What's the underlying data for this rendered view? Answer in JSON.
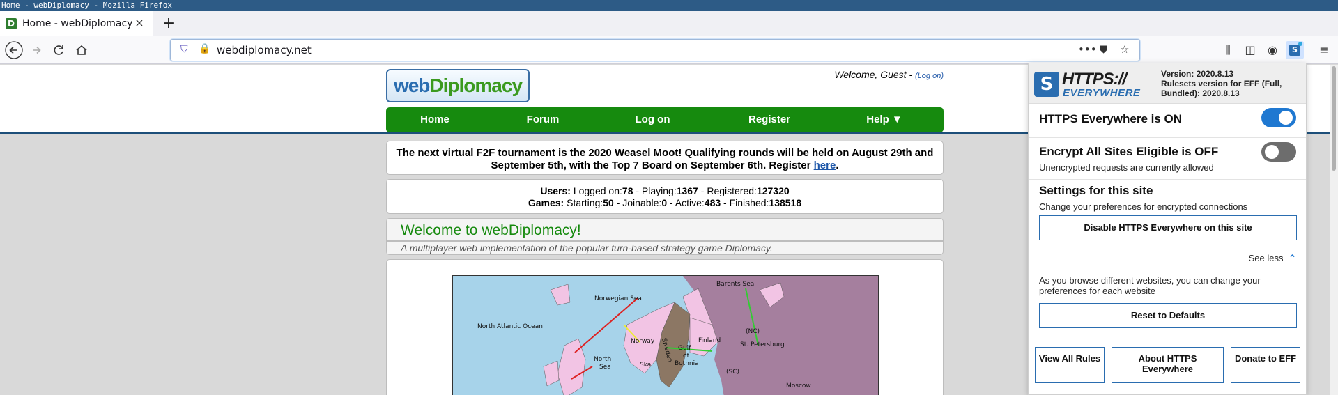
{
  "window": {
    "title": "Home - webDiplomacy - Mozilla Firefox"
  },
  "tab": {
    "title": "Home - webDiplomacy",
    "favicon_letter": "D",
    "close": "×"
  },
  "new_tab": "+",
  "address_bar": {
    "url": "webdiplomacy.net"
  },
  "site": {
    "logo_web": "web",
    "logo_diplomacy": "Diplomacy",
    "welcome_text": "Welcome, Guest - ",
    "welcome_login_open": "(",
    "welcome_login": "Log on",
    "welcome_login_close": ")",
    "menu": [
      "Home",
      "Forum",
      "Log on",
      "Register",
      "Help ▼"
    ],
    "announcement_text": "The next virtual F2F tournament is the 2020 Weasel Moot! Qualifying rounds will be held on August 29th and September 5th, with the Top 7 Board on September 6th. Register ",
    "announcement_link": "here",
    "announcement_end": ".",
    "stats": {
      "users_label": "Users:",
      "logged_on_label": " Logged on:",
      "logged_on": "78",
      "playing_label": " - Playing:",
      "playing": "1367",
      "registered_label": " - Registered:",
      "registered": "127320",
      "games_label": "Games:",
      "starting_label": " Starting:",
      "starting": "50",
      "joinable_label": " - Joinable:",
      "joinable": "0",
      "active_label": " - Active:",
      "active": "483",
      "finished_label": " - Finished:",
      "finished": "138518"
    },
    "welcome_title": "Welcome to webDiplomacy!",
    "welcome_subtitle": "A multiplayer web implementation of the popular turn-based strategy game Diplomacy.",
    "map_labels": {
      "nao": "North Atlantic Ocean",
      "nwg": "Norwegian Sea",
      "bar": "Barents Sea",
      "nor": "Norway",
      "swe": "Sweden",
      "fin": "Finland",
      "stp": "St. Petersburg",
      "bot1": "Gulf",
      "bot2": "of",
      "bot3": "Bothnia",
      "ska": "Ska",
      "nth1": "North",
      "nth2": "Sea",
      "mos": "Moscow",
      "nc": "(NC)",
      "sc": "(SC)"
    }
  },
  "https_everywhere": {
    "logo_line1": "HTTPS://",
    "logo_line2": "EVERYWHERE",
    "logo_badge": "S",
    "version": "Version: 2020.8.13",
    "ruleset": "Rulesets version for EFF (Full, Bundled): 2020.8.13",
    "on_title": "HTTPS Everywhere is ON",
    "on_state": true,
    "ease_title": "Encrypt All Sites Eligible is OFF",
    "ease_state": false,
    "ease_desc": "Unencrypted requests are currently allowed",
    "site_title": "Settings for this site",
    "site_desc": "Change your preferences for encrypted connections",
    "disable_button": "Disable HTTPS Everywhere on this site",
    "see_less": "See less",
    "browse_desc": "As you browse different websites, you can change your preferences for each website",
    "reset_button": "Reset to Defaults",
    "view_rules": "View All Rules",
    "about": "About HTTPS Everywhere",
    "donate": "Donate to EFF"
  },
  "colors": {
    "accent": "#1f78d1",
    "site_green": "#168a0e",
    "site_blue": "#1d4f7a"
  }
}
